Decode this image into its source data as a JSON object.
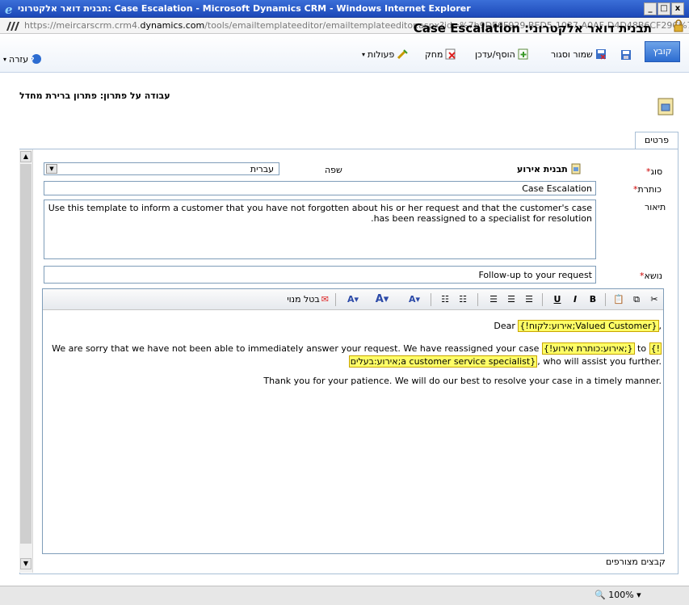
{
  "window": {
    "title": "תבנית דואר אלקטרוני: Case Escalation - Microsoft Dynamics CRM - Windows Internet Explorer",
    "btn_min": "_",
    "btn_max": "□",
    "btn_close": "x"
  },
  "address": {
    "prefix": "https://meircarscrm.crm4.",
    "domain": "dynamics.com",
    "path": "/tools/emailtemplateeditor/emailtemplateeditor.aspx?id=%7b9DE6F929-BED5-1037-A0AF-D4D48B6CF29C%7d"
  },
  "toolbar": {
    "file_tab": "קובץ",
    "save_close": "שמור וסגור",
    "insert_update": "הוסף/עדכן",
    "delete": "מחק",
    "actions": "פעולות",
    "help": "עזרה"
  },
  "header": {
    "title": "תבנית דואר אלקטרוני: Case Escalation",
    "work_on": "עבודה על פתרון: פתרון ברירת מחדל"
  },
  "tab": {
    "details": "פרטים"
  },
  "form": {
    "type_label": "סוג",
    "type_value": "תבנית אירוע",
    "language_label": "שפה",
    "language_value": "עברית",
    "title_label": "כותרת",
    "title_value": "Case Escalation",
    "description_label": "תיאור",
    "description_value": "Use this template to inform a customer that you have not forgotten about his or her request and that the customer's case has been reassigned to a specialist for resolution.",
    "subject_label": "נושא",
    "subject_value": "Follow-up to your request",
    "required_mark": "*",
    "attachments_label": "קבצים מצורפים"
  },
  "editor_toolbar": {
    "unsubscribe": "בטל מנוי",
    "bold": "B",
    "italic": "I",
    "underline": "U"
  },
  "editor": {
    "line1_dear": "Dear ",
    "line1_field": "{!אירוע:לקוח;Valued Customer}",
    "line1_end": ",",
    "line2_a": "We are sorry that we have not been able to immediately answer your request. We have reassigned your case ",
    "line2_field1": "{!אירוע:כותרת אירוע;}",
    "line2_to": " to ",
    "line2_field2": "{!",
    "line3_field": "אירוע:בעלים;a customer service specialist}",
    "line3_end": ", who will assist you further.",
    "line4": "Thank you for your patience. We will do our best to resolve your case in a timely manner."
  },
  "statusbar": {
    "zoom": "100%"
  }
}
